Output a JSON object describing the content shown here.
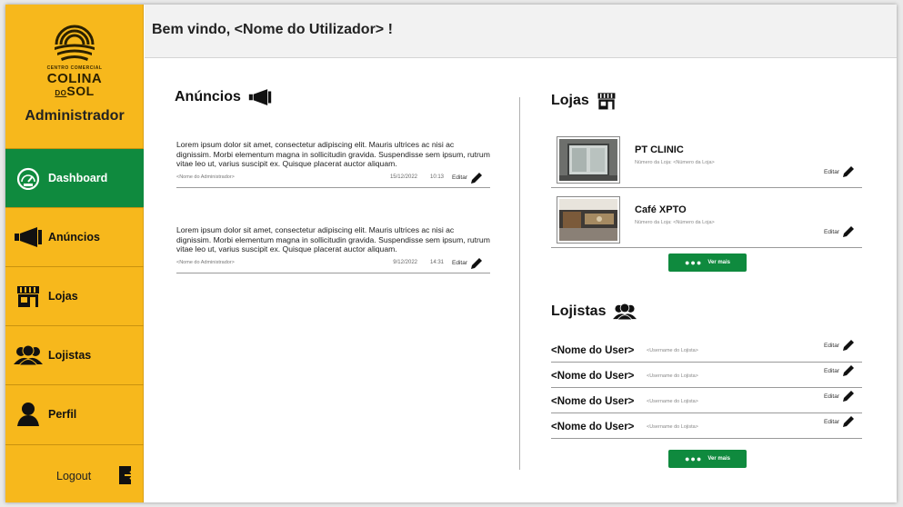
{
  "sidebar": {
    "logo": {
      "small": "CENTRO COMERCIAL",
      "colina": "COLINA",
      "do": "DO",
      "sol": "SOL"
    },
    "role": "Administrador",
    "nav": [
      {
        "label": "Dashboard",
        "icon": "gauge-icon",
        "active": true
      },
      {
        "label": "Anúncios",
        "icon": "megaphone-icon",
        "active": false
      },
      {
        "label": "Lojas",
        "icon": "store-icon",
        "active": false
      },
      {
        "label": "Lojistas",
        "icon": "group-icon",
        "active": false
      },
      {
        "label": "Perfil",
        "icon": "person-icon",
        "active": false
      }
    ],
    "logout_label": "Logout"
  },
  "header": {
    "welcome": "Bem vindo, <Nome do Utilizador> !"
  },
  "announcements": {
    "title": "Anúncios",
    "items": [
      {
        "text": "Lorem ipsum dolor sit amet, consectetur adipiscing elit. Mauris ultrices ac nisi ac dignissim. Morbi elementum magna in sollicitudin gravida. Suspendisse sem ipsum, rutrum vitae leo ut, varius suscipit ex. Quisque placerat auctor aliquam.",
        "author": "<Nome do Administrador>",
        "date": "15/12/2022",
        "time": "10:13",
        "edit": "Editar"
      },
      {
        "text": "Lorem ipsum dolor sit amet, consectetur adipiscing elit. Mauris ultrices ac nisi ac dignissim. Morbi elementum magna in sollicitudin gravida. Suspendisse sem ipsum, rutrum vitae leo ut, varius suscipit ex. Quisque placerat auctor aliquam.",
        "author": "<Nome do Administrador>",
        "date": "9/12/2022",
        "time": "14:31",
        "edit": "Editar"
      }
    ]
  },
  "stores": {
    "title": "Lojas",
    "items": [
      {
        "name": "PT CLINIC",
        "number": "Número da Loja: <Número da Loja>",
        "edit": "Editar"
      },
      {
        "name": "Café XPTO",
        "number": "Número da Loja: <Número da Loja>",
        "edit": "Editar"
      }
    ],
    "more": "Ver mais"
  },
  "tenants": {
    "title": "Lojistas",
    "items": [
      {
        "name": "<Nome do User>",
        "username": "<Username do Lojista>",
        "edit": "Editar"
      },
      {
        "name": "<Nome do User>",
        "username": "<Username do Lojista>",
        "edit": "Editar"
      },
      {
        "name": "<Nome do User>",
        "username": "<Username do Lojista>",
        "edit": "Editar"
      },
      {
        "name": "<Nome do User>",
        "username": "<Username do Lojista>",
        "edit": "Editar"
      }
    ],
    "more": "Ver mais"
  },
  "colors": {
    "sidebar": "#f7b81c",
    "accent_green": "#0f8a3e",
    "header": "#f2f2f2"
  }
}
